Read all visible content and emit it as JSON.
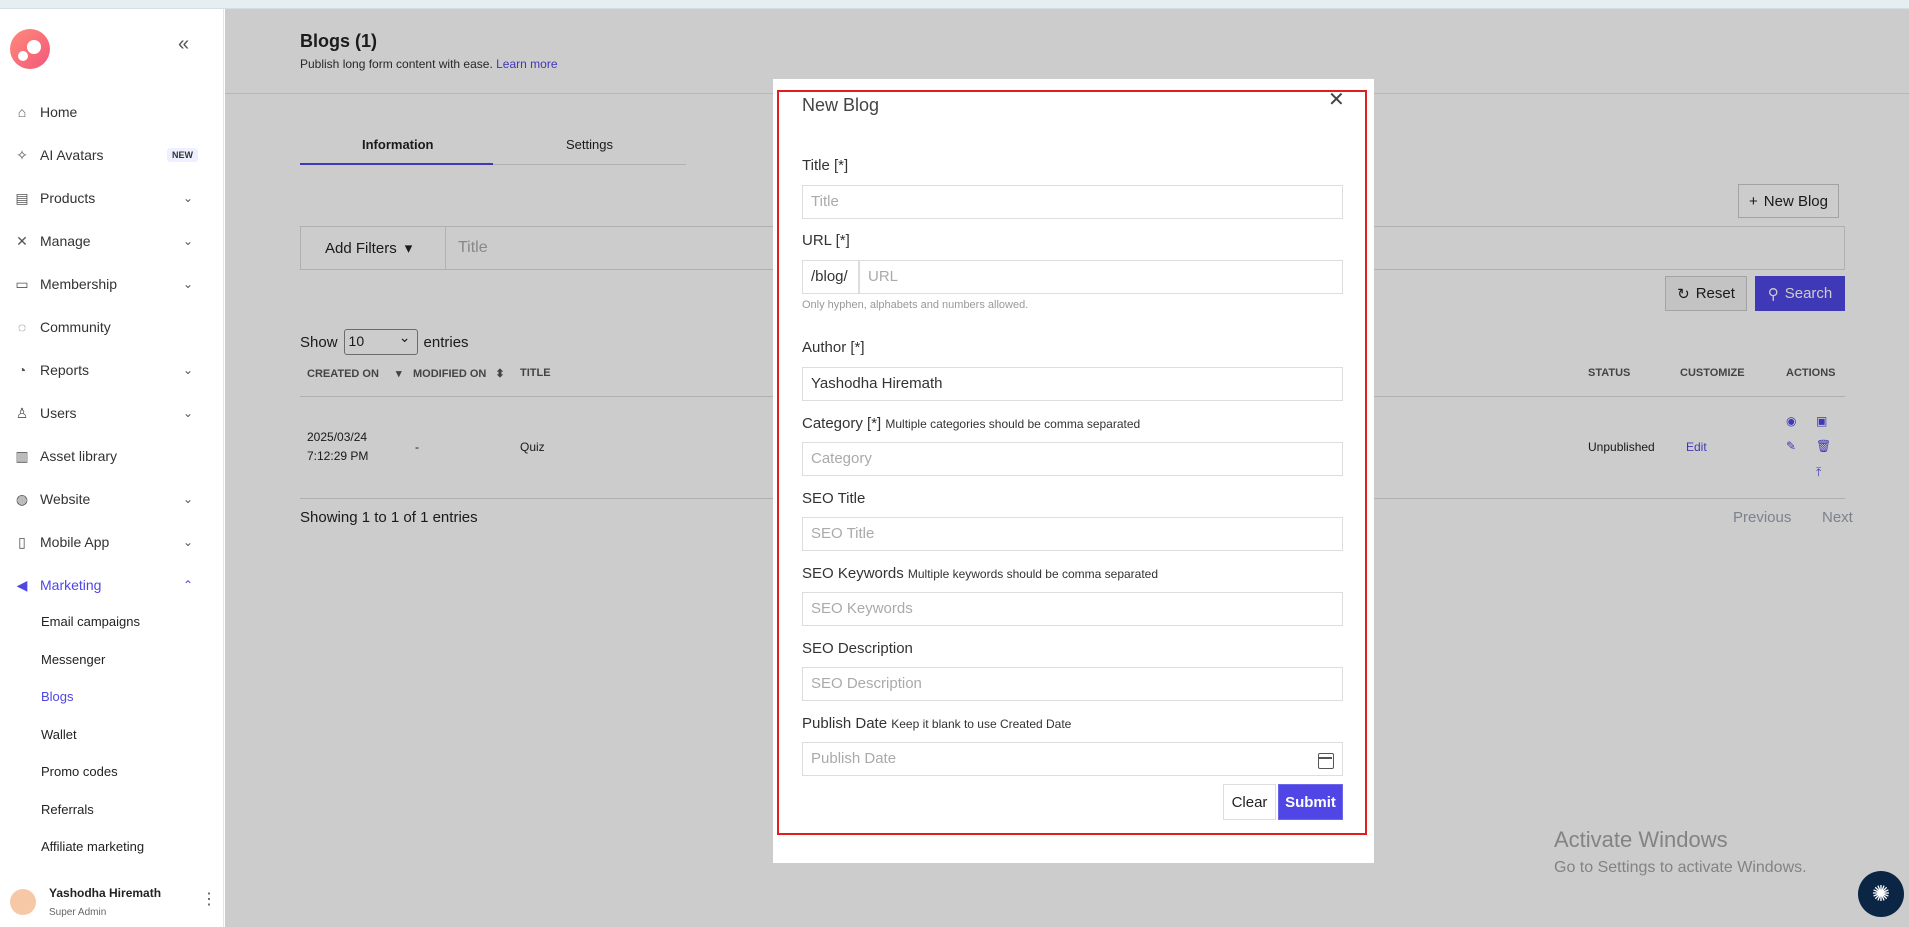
{
  "sidebar": {
    "collapse_icon": "double-chevron-left-icon",
    "items": [
      {
        "label": "Home",
        "icon": "home-icon"
      },
      {
        "label": "AI Avatars",
        "icon": "sparkle-icon",
        "badge": "NEW"
      },
      {
        "label": "Products",
        "icon": "archive-icon"
      },
      {
        "label": "Manage",
        "icon": "tools-icon"
      },
      {
        "label": "Membership",
        "icon": "ticket-icon"
      },
      {
        "label": "Community",
        "icon": "chat-icon"
      },
      {
        "label": "Reports",
        "icon": "pie-chart-icon"
      },
      {
        "label": "Users",
        "icon": "user-icon"
      },
      {
        "label": "Asset library",
        "icon": "book-icon"
      },
      {
        "label": "Website",
        "icon": "globe-icon"
      },
      {
        "label": "Mobile App",
        "icon": "phone-icon"
      },
      {
        "label": "Marketing",
        "icon": "megaphone-icon"
      }
    ],
    "marketing_sub": [
      "Email campaigns",
      "Messenger",
      "Blogs",
      "Wallet",
      "Promo codes",
      "Referrals",
      "Affiliate marketing"
    ],
    "user": {
      "name": "Yashodha Hiremath",
      "role": "Super Admin"
    }
  },
  "page": {
    "title": "Blogs (1)",
    "subtitle": "Publish long form content with ease.",
    "learn_more": "Learn more",
    "tabs": [
      "Information",
      "Settings"
    ],
    "new_blog": "New Blog",
    "add_filters": "Add Filters",
    "filter_placeholder": "Title",
    "reset": "Reset",
    "search": "Search",
    "show": "Show",
    "entries_value": "10",
    "entries": "entries",
    "columns": {
      "created": "CREATED ON",
      "modified": "MODIFIED ON",
      "title": "TITLE",
      "status": "STATUS",
      "customize": "CUSTOMIZE",
      "actions": "ACTIONS"
    },
    "row": {
      "created_date": "2025/03/24",
      "created_time": "7:12:29 PM",
      "modified": "-",
      "title": "Quiz",
      "status": "Unpublished",
      "customize": "Edit"
    },
    "showing": "Showing 1 to 1 of 1 entries",
    "previous": "Previous",
    "next": "Next"
  },
  "modal": {
    "title": "New Blog",
    "title_label": "Title [*]",
    "title_placeholder": "Title",
    "url_label": "URL [*]",
    "url_prefix": "/blog/",
    "url_placeholder": "URL",
    "url_help": "Only hyphen, alphabets and numbers allowed.",
    "author_label": "Author [*]",
    "author_value": "Yashodha Hiremath",
    "category_label": "Category [*]",
    "category_hint": "Multiple categories should be comma separated",
    "category_placeholder": "Category",
    "seo_title_label": "SEO Title",
    "seo_title_placeholder": "SEO Title",
    "seo_keywords_label": "SEO Keywords",
    "seo_keywords_hint": "Multiple keywords should be comma separated",
    "seo_keywords_placeholder": "SEO Keywords",
    "seo_desc_label": "SEO Description",
    "seo_desc_placeholder": "SEO Description",
    "publish_label": "Publish Date",
    "publish_hint": "Keep it blank to use Created Date",
    "publish_placeholder": "Publish Date",
    "clear": "Clear",
    "submit": "Submit"
  },
  "watermark": {
    "line1": "Activate Windows",
    "line2": "Go to Settings to activate Windows."
  },
  "colors": {
    "accent": "#4f46e5",
    "highlight_border": "#e11d1d"
  }
}
